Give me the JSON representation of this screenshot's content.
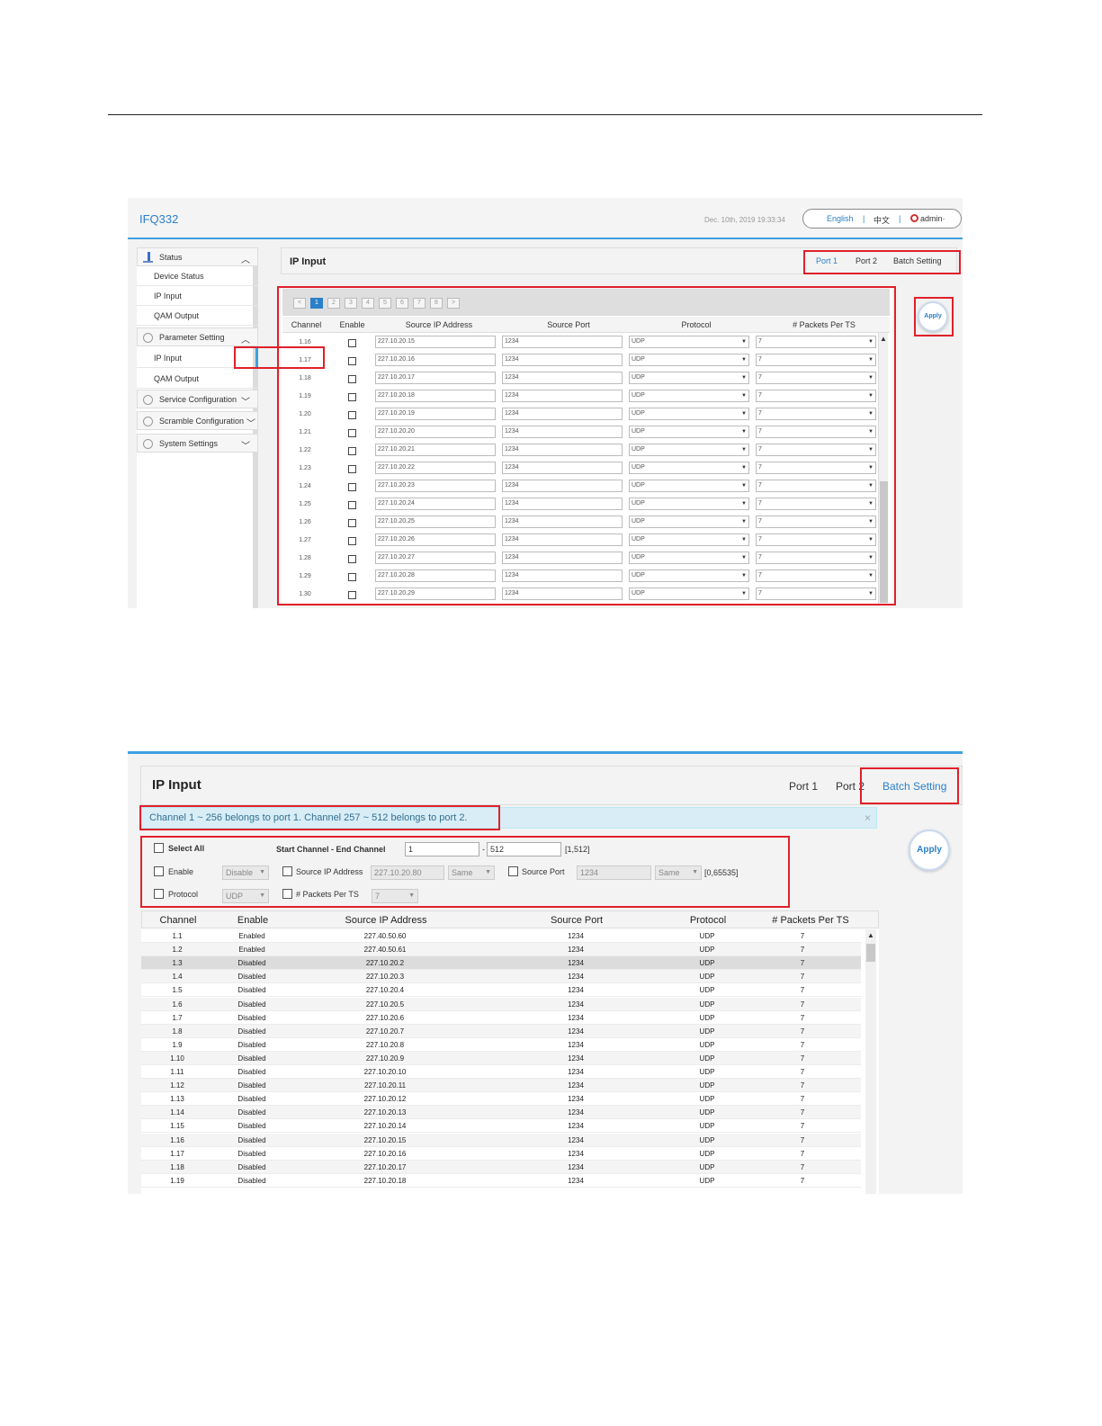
{
  "shot1": {
    "brand": "IFQ332",
    "datetime": "Dec. 10th, 2019 19:33:34",
    "lang": {
      "english": "English",
      "sep": "|",
      "chinese": "中文",
      "user": "admin·"
    },
    "sidebar": {
      "status_group": "Status",
      "status_items": [
        "Device Status",
        "IP Input",
        "QAM Output"
      ],
      "param_group": "Parameter Setting",
      "param_items": [
        "IP Input",
        "QAM Output"
      ],
      "service_group": "Service Configuration",
      "scramble_group": "Scramble Configuration",
      "system_group": "System Settings"
    },
    "panel_title": "IP Input",
    "tabs": [
      "Port 1",
      "Port 2",
      "Batch Setting"
    ],
    "pager": [
      "<",
      "1",
      "2",
      "3",
      "4",
      "5",
      "6",
      "7",
      "8",
      ">"
    ],
    "columns": [
      "Channel",
      "Enable",
      "Source IP Address",
      "Source Port",
      "Protocol",
      "# Packets Per TS"
    ],
    "rows": [
      {
        "channel": "1.16",
        "ip": "227.10.20.15",
        "port": "1234",
        "protocol": "UDP",
        "packets": "7"
      },
      {
        "channel": "1.17",
        "ip": "227.10.20.16",
        "port": "1234",
        "protocol": "UDP",
        "packets": "7"
      },
      {
        "channel": "1.18",
        "ip": "227.10.20.17",
        "port": "1234",
        "protocol": "UDP",
        "packets": "7"
      },
      {
        "channel": "1.19",
        "ip": "227.10.20.18",
        "port": "1234",
        "protocol": "UDP",
        "packets": "7"
      },
      {
        "channel": "1.20",
        "ip": "227.10.20.19",
        "port": "1234",
        "protocol": "UDP",
        "packets": "7"
      },
      {
        "channel": "1.21",
        "ip": "227.10.20.20",
        "port": "1234",
        "protocol": "UDP",
        "packets": "7"
      },
      {
        "channel": "1.22",
        "ip": "227.10.20.21",
        "port": "1234",
        "protocol": "UDP",
        "packets": "7"
      },
      {
        "channel": "1.23",
        "ip": "227.10.20.22",
        "port": "1234",
        "protocol": "UDP",
        "packets": "7"
      },
      {
        "channel": "1.24",
        "ip": "227.10.20.23",
        "port": "1234",
        "protocol": "UDP",
        "packets": "7"
      },
      {
        "channel": "1.25",
        "ip": "227.10.20.24",
        "port": "1234",
        "protocol": "UDP",
        "packets": "7"
      },
      {
        "channel": "1.26",
        "ip": "227.10.20.25",
        "port": "1234",
        "protocol": "UDP",
        "packets": "7"
      },
      {
        "channel": "1.27",
        "ip": "227.10.20.26",
        "port": "1234",
        "protocol": "UDP",
        "packets": "7"
      },
      {
        "channel": "1.28",
        "ip": "227.10.20.27",
        "port": "1234",
        "protocol": "UDP",
        "packets": "7"
      },
      {
        "channel": "1.29",
        "ip": "227.10.20.28",
        "port": "1234",
        "protocol": "UDP",
        "packets": "7"
      },
      {
        "channel": "1.30",
        "ip": "227.10.20.29",
        "port": "1234",
        "protocol": "UDP",
        "packets": "7"
      }
    ],
    "apply": "Apply"
  },
  "shot2": {
    "panel_title": "IP Input",
    "tabs": [
      "Port 1",
      "Port 2",
      "Batch Setting"
    ],
    "info": "Channel 1 ~ 256 belongs to port 1. Channel 257 ~ 512 belongs to port 2.",
    "info_close": "×",
    "apply": "Apply",
    "form": {
      "select_all": "Select All",
      "range_label": "Start Channel - End Channel",
      "start": "1",
      "dash": "-",
      "end": "512",
      "range_hint": "[1,512]",
      "enable_label": "Enable",
      "enable_value": "Disable",
      "src_ip_label": "Source IP Address",
      "src_ip_value": "227.10.20.80",
      "src_ip_mode": "Same",
      "src_port_label": "Source Port",
      "src_port_value": "1234",
      "src_port_mode": "Same",
      "port_hint": "[0,65535]",
      "protocol_label": "Protocol",
      "protocol_value": "UDP",
      "packets_label": "# Packets Per TS",
      "packets_value": "7"
    },
    "columns": [
      "Channel",
      "Enable",
      "Source IP Address",
      "Source Port",
      "Protocol",
      "# Packets Per TS"
    ],
    "rows": [
      {
        "channel": "1.1",
        "enable": "Enabled",
        "ip": "227.40.50.60",
        "port": "1234",
        "protocol": "UDP",
        "packets": "7"
      },
      {
        "channel": "1.2",
        "enable": "Enabled",
        "ip": "227.40.50.61",
        "port": "1234",
        "protocol": "UDP",
        "packets": "7"
      },
      {
        "channel": "1.3",
        "enable": "Disabled",
        "ip": "227.10.20.2",
        "port": "1234",
        "protocol": "UDP",
        "packets": "7"
      },
      {
        "channel": "1.4",
        "enable": "Disabled",
        "ip": "227.10.20.3",
        "port": "1234",
        "protocol": "UDP",
        "packets": "7"
      },
      {
        "channel": "1.5",
        "enable": "Disabled",
        "ip": "227.10.20.4",
        "port": "1234",
        "protocol": "UDP",
        "packets": "7"
      },
      {
        "channel": "1.6",
        "enable": "Disabled",
        "ip": "227.10.20.5",
        "port": "1234",
        "protocol": "UDP",
        "packets": "7"
      },
      {
        "channel": "1.7",
        "enable": "Disabled",
        "ip": "227.10.20.6",
        "port": "1234",
        "protocol": "UDP",
        "packets": "7"
      },
      {
        "channel": "1.8",
        "enable": "Disabled",
        "ip": "227.10.20.7",
        "port": "1234",
        "protocol": "UDP",
        "packets": "7"
      },
      {
        "channel": "1.9",
        "enable": "Disabled",
        "ip": "227.10.20.8",
        "port": "1234",
        "protocol": "UDP",
        "packets": "7"
      },
      {
        "channel": "1.10",
        "enable": "Disabled",
        "ip": "227.10.20.9",
        "port": "1234",
        "protocol": "UDP",
        "packets": "7"
      },
      {
        "channel": "1.11",
        "enable": "Disabled",
        "ip": "227.10.20.10",
        "port": "1234",
        "protocol": "UDP",
        "packets": "7"
      },
      {
        "channel": "1.12",
        "enable": "Disabled",
        "ip": "227.10.20.11",
        "port": "1234",
        "protocol": "UDP",
        "packets": "7"
      },
      {
        "channel": "1.13",
        "enable": "Disabled",
        "ip": "227.10.20.12",
        "port": "1234",
        "protocol": "UDP",
        "packets": "7"
      },
      {
        "channel": "1.14",
        "enable": "Disabled",
        "ip": "227.10.20.13",
        "port": "1234",
        "protocol": "UDP",
        "packets": "7"
      },
      {
        "channel": "1.15",
        "enable": "Disabled",
        "ip": "227.10.20.14",
        "port": "1234",
        "protocol": "UDP",
        "packets": "7"
      },
      {
        "channel": "1.16",
        "enable": "Disabled",
        "ip": "227.10.20.15",
        "port": "1234",
        "protocol": "UDP",
        "packets": "7"
      },
      {
        "channel": "1.17",
        "enable": "Disabled",
        "ip": "227.10.20.16",
        "port": "1234",
        "protocol": "UDP",
        "packets": "7"
      },
      {
        "channel": "1.18",
        "enable": "Disabled",
        "ip": "227.10.20.17",
        "port": "1234",
        "protocol": "UDP",
        "packets": "7"
      },
      {
        "channel": "1.19",
        "enable": "Disabled",
        "ip": "227.10.20.18",
        "port": "1234",
        "protocol": "UDP",
        "packets": "7"
      }
    ]
  }
}
